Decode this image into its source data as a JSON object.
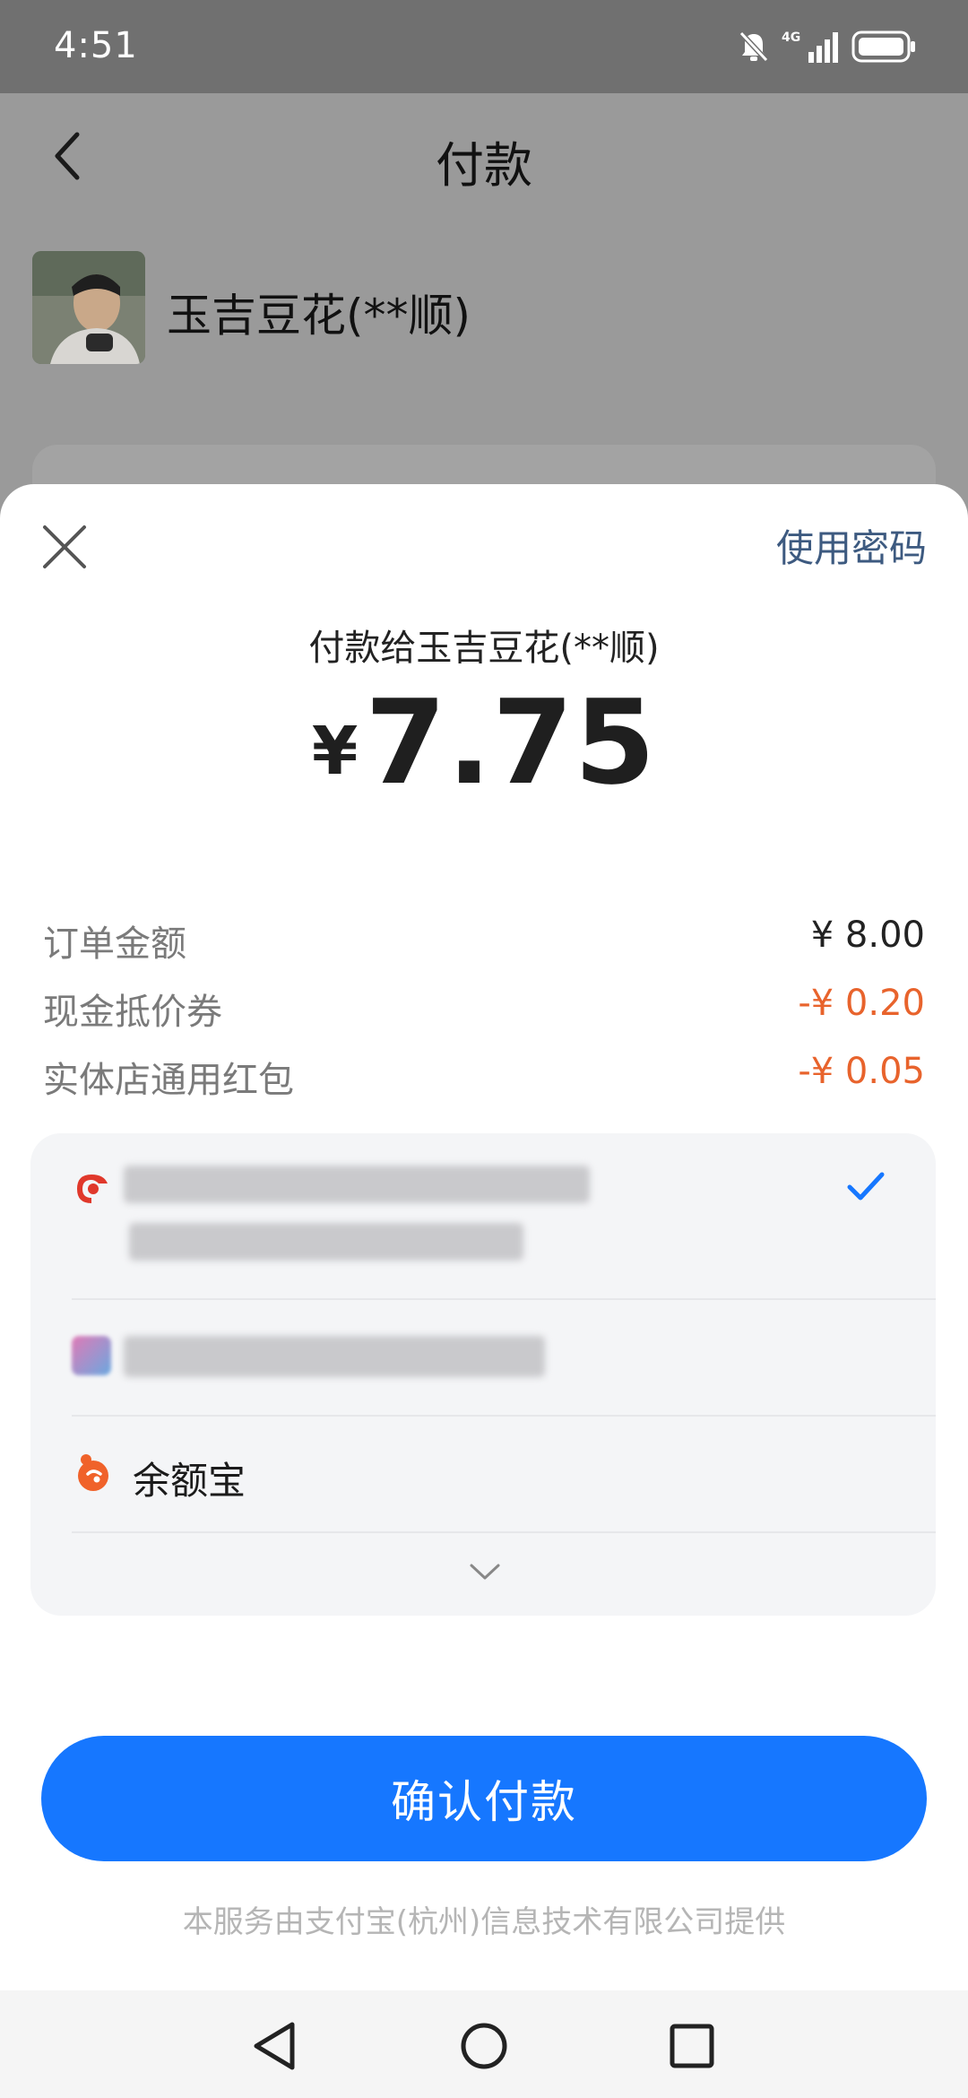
{
  "status_bar": {
    "time": "4:51",
    "network": "4G",
    "icons": [
      "bell-muted-icon",
      "signal-icon",
      "battery-icon"
    ]
  },
  "background_page": {
    "title": "付款",
    "merchant_name": "玉吉豆花(**顺)"
  },
  "sheet": {
    "use_password": "使用密码",
    "pay_to": "付款给玉吉豆花(**顺)",
    "currency": "¥",
    "amount": "7.75",
    "fees": [
      {
        "label": "订单金额",
        "value": "¥ 8.00"
      },
      {
        "label": "现金抵价券",
        "value": "-¥ 0.20"
      },
      {
        "label": "实体店通用红包",
        "value": "-¥ 0.05"
      }
    ],
    "payment_methods": {
      "balance_label": "余额宝"
    },
    "confirm_button": "确认付款",
    "provider_note": "本服务由支付宝(杭州)信息技术有限公司提供"
  },
  "colors": {
    "accent": "#1677ff",
    "discount": "#e8632c",
    "link": "#3d5a80"
  }
}
